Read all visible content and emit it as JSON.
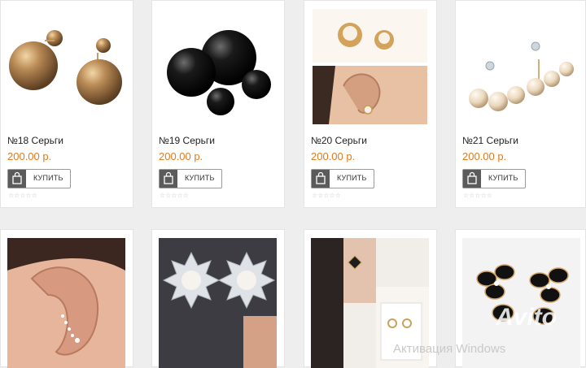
{
  "buy_label": "КУПИТЬ",
  "rating_stars": "☆☆☆☆☆",
  "price_color": "#e27a1e",
  "products": [
    {
      "title": "№18 Серьги",
      "price": "200.00 р."
    },
    {
      "title": "№19 Серьги",
      "price": "200.00 р."
    },
    {
      "title": "№20 Серьги",
      "price": "200.00 р."
    },
    {
      "title": "№21 Серьги",
      "price": "200.00 р."
    }
  ],
  "overlay": {
    "avito_watermark": "Avito",
    "windows_activation": "Активация Windows"
  }
}
